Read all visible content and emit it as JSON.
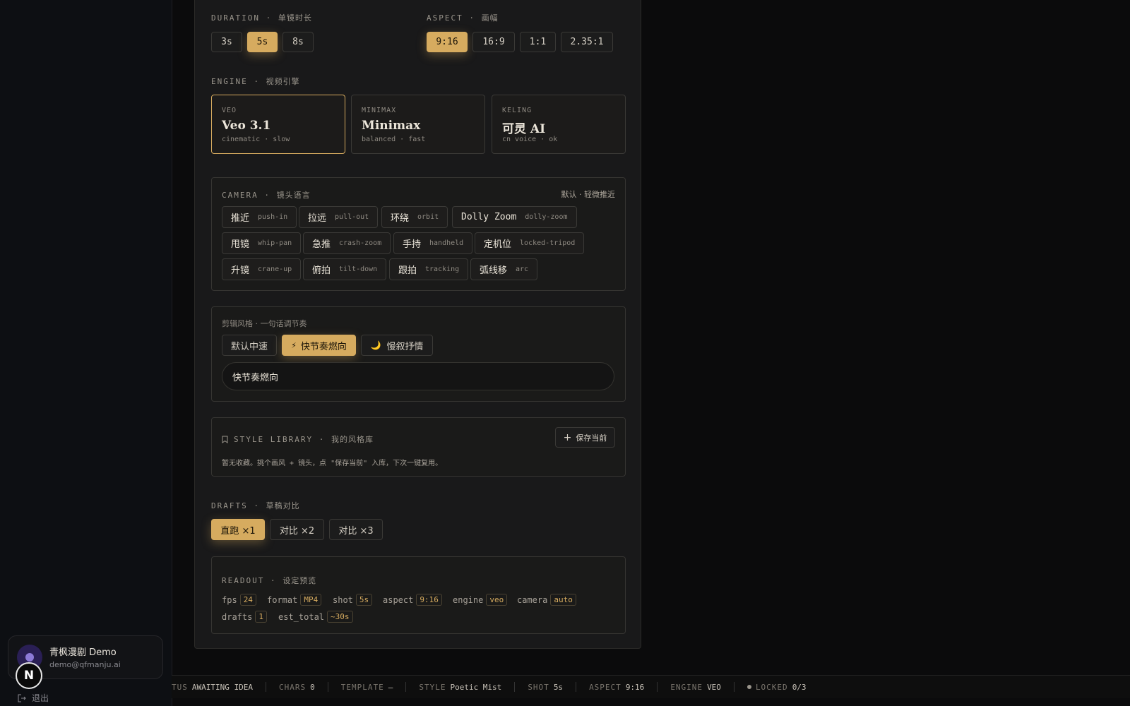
{
  "sidebar": {
    "user_name": "青枫漫剧 Demo",
    "user_email": "demo@qfmanju.ai",
    "badge_letter": "N",
    "logout_label": "退出"
  },
  "duration": {
    "label": "DURATION",
    "label_zh": "单镜时长",
    "options": [
      "3s",
      "5s",
      "8s"
    ],
    "selected": "5s"
  },
  "aspect": {
    "label": "ASPECT",
    "label_zh": "画幅",
    "options": [
      "9:16",
      "16:9",
      "1:1",
      "2.35:1"
    ],
    "selected": "9:16"
  },
  "engine": {
    "label": "ENGINE",
    "label_zh": "视频引擎",
    "options": [
      {
        "code": "VEO",
        "name": "Veo 3.1",
        "desc": "cinematic · slow"
      },
      {
        "code": "MINIMAX",
        "name": "Minimax",
        "desc": "balanced · fast"
      },
      {
        "code": "KELING",
        "name": "可灵 AI",
        "desc": "cn voice · ok"
      }
    ],
    "selected": "VEO"
  },
  "camera": {
    "label": "CAMERA",
    "label_zh": "镜头语言",
    "hint": "默认 · 轻微推近",
    "moves": [
      {
        "zh": "推近",
        "en": "push-in"
      },
      {
        "zh": "拉远",
        "en": "pull-out"
      },
      {
        "zh": "环绕",
        "en": "orbit"
      },
      {
        "zh": "Dolly Zoom",
        "en": "dolly-zoom"
      },
      {
        "zh": "甩镜",
        "en": "whip-pan"
      },
      {
        "zh": "急推",
        "en": "crash-zoom"
      },
      {
        "zh": "手持",
        "en": "handheld"
      },
      {
        "zh": "定机位",
        "en": "locked-tripod"
      },
      {
        "zh": "升镜",
        "en": "crane-up"
      },
      {
        "zh": "俯拍",
        "en": "tilt-down"
      },
      {
        "zh": "跟拍",
        "en": "tracking"
      },
      {
        "zh": "弧线移",
        "en": "arc"
      }
    ]
  },
  "edit_style": {
    "label": "剪辑风格 · 一句话调节奏",
    "options": [
      "默认中速",
      "快节奏燃向",
      "慢叙抒情"
    ],
    "selected": "快节奏燃向",
    "input_value": "快节奏燃向"
  },
  "style_library": {
    "label": "STYLE LIBRARY",
    "label_zh": "我的风格库",
    "save_label": "保存当前",
    "empty_text": "暂无收藏。挑个画风 + 镜头，点 \"保存当前\" 入库，下次一键复用。"
  },
  "drafts": {
    "label": "DRAFTS",
    "label_zh": "草稿对比",
    "options": [
      "直跑 ×1",
      "对比 ×2",
      "对比 ×3"
    ],
    "selected": "直跑 ×1"
  },
  "readout": {
    "label": "READOUT",
    "label_zh": "设定预览",
    "items": [
      {
        "k": "fps",
        "v": "24"
      },
      {
        "k": "format",
        "v": "MP4"
      },
      {
        "k": "shot",
        "v": "5s"
      },
      {
        "k": "aspect",
        "v": "9:16"
      },
      {
        "k": "engine",
        "v": "veo"
      },
      {
        "k": "camera",
        "v": "auto"
      },
      {
        "k": "drafts",
        "v": "1"
      },
      {
        "k": "est_total",
        "v": "~30s"
      }
    ]
  },
  "statusbar": {
    "items": [
      {
        "k": "TUS",
        "v": "AWAITING IDEA"
      },
      {
        "k": "CHARS",
        "v": "0"
      },
      {
        "k": "TEMPLATE",
        "v": "—"
      },
      {
        "k": "STYLE",
        "v": "Poetic Mist"
      },
      {
        "k": "SHOT",
        "v": "5s"
      },
      {
        "k": "ASPECT",
        "v": "9:16"
      },
      {
        "k": "ENGINE",
        "v": "VEO"
      },
      {
        "k": "LOCKED",
        "v": "0/3"
      }
    ]
  },
  "colors": {
    "accent": "#d6ab5f",
    "panel": "#19191a",
    "background": "#0b0b0c"
  }
}
